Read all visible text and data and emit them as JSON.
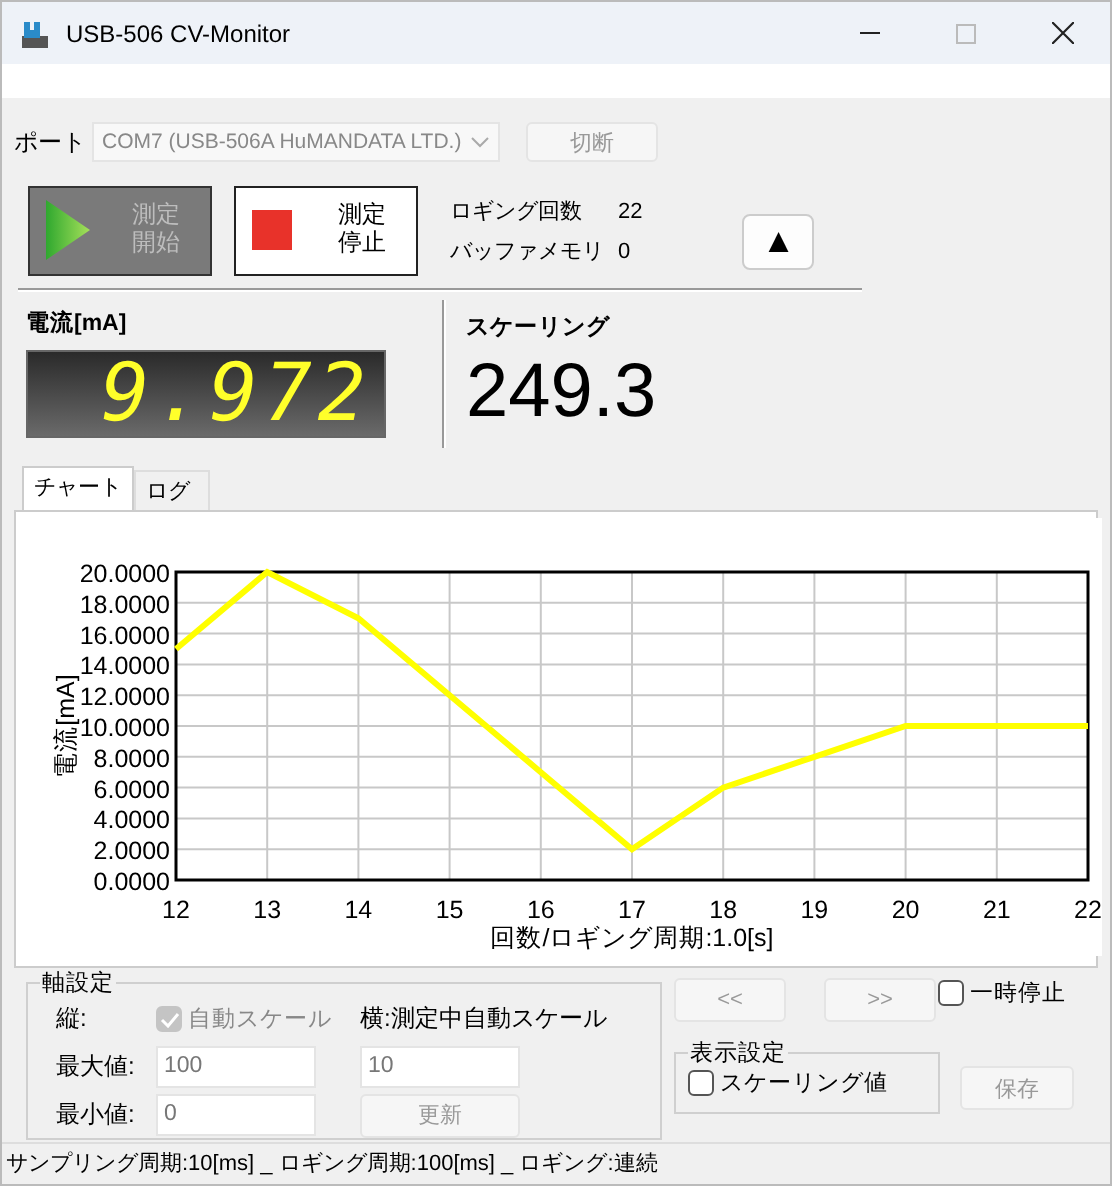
{
  "window": {
    "title": "USB-506 CV-Monitor"
  },
  "port": {
    "label": "ポート",
    "value": "COM7 (USB-506A HuMANDATA LTD.)",
    "disabled": true,
    "disconnect_button": {
      "label": "切断",
      "disabled": true
    }
  },
  "start_button": {
    "label": "測定開始",
    "disabled": true
  },
  "stop_button": {
    "label": "測定停止",
    "disabled": false
  },
  "logging_count": {
    "label": "ロギング回数",
    "value": "22"
  },
  "buffer_memory": {
    "label": "バッファメモリ",
    "value": "0"
  },
  "up_button": {
    "label": "▲"
  },
  "current": {
    "label": "電流[mA]",
    "value": "9.972"
  },
  "scaling": {
    "label": "スケーリング",
    "value": "249.3"
  },
  "tabs": [
    {
      "label": "チャート",
      "selected": true
    },
    {
      "label": "ログ",
      "selected": false
    }
  ],
  "chart_data": {
    "type": "line",
    "xlabel": "回数/ロギング周期:1.0[s]",
    "ylabel": "電流[mA]",
    "x": [
      12,
      13,
      14,
      15,
      16,
      17,
      18,
      19,
      20,
      21,
      22
    ],
    "grid": true,
    "series": [
      {
        "color": "#ffff00",
        "values": [
          15,
          20,
          17,
          12,
          7,
          2,
          6,
          8,
          10,
          10,
          10
        ]
      }
    ],
    "xlim": [
      12,
      22
    ],
    "ylim": [
      0,
      20
    ],
    "xticks": [
      12,
      13,
      14,
      15,
      16,
      17,
      18,
      19,
      20,
      21,
      22
    ],
    "yticks": [
      {
        "value": 0,
        "label": "0.0000"
      },
      {
        "value": 2,
        "label": "2.0000"
      },
      {
        "value": 4,
        "label": "4.0000"
      },
      {
        "value": 6,
        "label": "6.0000"
      },
      {
        "value": 8,
        "label": "8.0000"
      },
      {
        "value": 10,
        "label": "10.0000"
      },
      {
        "value": 12,
        "label": "12.0000"
      },
      {
        "value": 14,
        "label": "14.0000"
      },
      {
        "value": 16,
        "label": "16.0000"
      },
      {
        "value": 18,
        "label": "18.0000"
      },
      {
        "value": 20,
        "label": "20.0000"
      }
    ]
  },
  "axis_settings": {
    "title": "軸設定",
    "vertical_label": "縦:",
    "auto_scale": {
      "label": "自動スケール",
      "checked": true,
      "disabled": true
    },
    "max_label": "最大値:",
    "max_value": "100",
    "min_label": "最小値:",
    "min_value": "0",
    "horizontal_label": "横:測定中自動スケール",
    "horizontal_value": "10",
    "update_button": {
      "label": "更新",
      "disabled": true
    }
  },
  "prev_button": {
    "label": "<<",
    "disabled": true
  },
  "next_button": {
    "label": ">>",
    "disabled": true
  },
  "pause": {
    "label": "一時停止",
    "checked": false
  },
  "display_settings": {
    "title": "表示設定",
    "scaling_value": {
      "label": "スケーリング値",
      "checked": false
    }
  },
  "save_button": {
    "label": "保存",
    "disabled": true
  },
  "status_bar": "サンプリング周期:10[ms] _ ロギング周期:100[ms] _ ロギング:連続"
}
